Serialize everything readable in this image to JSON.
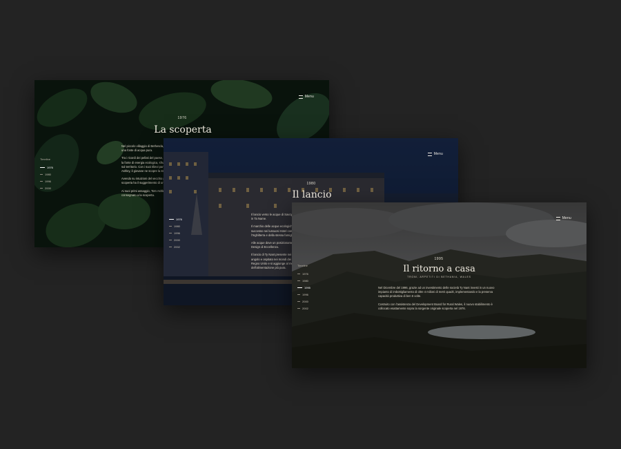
{
  "cards": [
    {
      "menu_label": "Menu",
      "year": "1976",
      "title": "La scoperta",
      "timeline_label": "Timeline",
      "timeline": [
        "1976",
        "1980",
        "1996",
        "2000"
      ],
      "paragraphs": [
        "Nel piccolo villaggio di Bethesda, la scoperta di una fonte di acqua pura.",
        "Tra i ricordi dei pellati del paese, riesce a trovare la fonte di energia ecologica, sfruttando le acque sul territorio. Con i suoi rilievi particolari, Tom Ashley, il giovane ne scopre la storia e l'infanzia.",
        "Avendo su intuizioni del vecchio profilo e la sua scoperta ha il suggerimento di un orecchio.",
        "Ai suoi primi assaggio, Tom Ashley e le ha consegnato a la scoperta."
      ]
    },
    {
      "menu_label": "Menu",
      "year": "1980",
      "title": "Il lancio",
      "timeline": [
        "1976",
        "1980",
        "1996",
        "2000",
        "2002"
      ],
      "paragraphs": [
        "Il lancio verso le acque di Savoy Hotel, trasformata in Ta Name.",
        "Il marchio delle acque ecologiche è stato un successo nei lussuosi Hotel come Savoy, l'Inghilterra e della stessa famiglia Silver Cellars.",
        "Alle acque dove un posizionamento ottimo per Design di Eccellenza.",
        "Il lancio di Ty Nant presente nei luoghi di ogni angolo e ospitato nei mondi dei grandi ristoranti del Regno Unito e si aggiunge al mercato dell'alimentazione più pura."
      ]
    },
    {
      "menu_label": "Menu",
      "year": "1995",
      "title": "Il ritorno a casa",
      "subtitle": "TRONI, ARPETITI DI BETHANIA, WALES",
      "timeline_label": "Timeline",
      "timeline": [
        "1976",
        "1980",
        "1995",
        "1996",
        "2000",
        "2002"
      ],
      "paragraphs": [
        "Nel Dicembre del 1996, grazie ad un investimento delle società Ty Nant investi in un nuovo impianto di imbottigliamento di oltre 4 milioni di metri quadri, implementando e la preserva capacità produttiva di ben 5 volte.",
        "Costruito con l'assistenza del Development Board for Rural Wales, il nuovo stabilimento è collocato esattamente sopra la sorgente originale scoperta nel 1976."
      ]
    }
  ]
}
